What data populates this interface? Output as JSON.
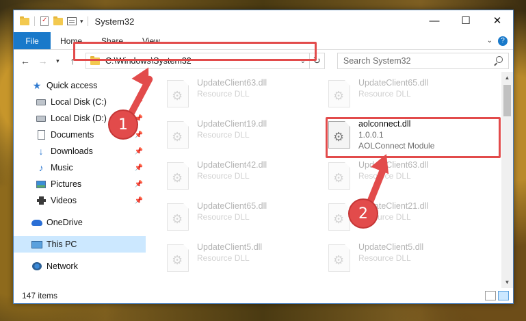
{
  "window": {
    "title": "System32",
    "controls": {
      "minimize": "—",
      "maximize": "☐",
      "close": "✕"
    }
  },
  "ribbon": {
    "tabs": [
      "File",
      "Home",
      "Share",
      "View"
    ]
  },
  "address": {
    "path": "C:\\Windows\\System32"
  },
  "search": {
    "placeholder": "Search System32"
  },
  "nav": {
    "items": [
      {
        "label": "Quick access",
        "icon": "star-icon",
        "pinned": false
      },
      {
        "label": "Local Disk (C:)",
        "icon": "drive-icon",
        "pinned": true
      },
      {
        "label": "Local Disk (D:)",
        "icon": "drive-icon",
        "pinned": true
      },
      {
        "label": "Documents",
        "icon": "documents-icon",
        "pinned": true
      },
      {
        "label": "Downloads",
        "icon": "download-icon",
        "pinned": true
      },
      {
        "label": "Music",
        "icon": "music-icon",
        "pinned": true
      },
      {
        "label": "Pictures",
        "icon": "pictures-icon",
        "pinned": true
      },
      {
        "label": "Videos",
        "icon": "videos-icon",
        "pinned": true
      },
      {
        "label": "OneDrive",
        "icon": "onedrive-icon",
        "pinned": false
      },
      {
        "label": "This PC",
        "icon": "this-pc-icon",
        "pinned": false
      },
      {
        "label": "Network",
        "icon": "network-icon",
        "pinned": false
      }
    ]
  },
  "files": [
    {
      "name": "UpdateClient63.dll",
      "type": "Resource DLL"
    },
    {
      "name": "UpdateClient65.dll",
      "type": "Resource DLL"
    },
    {
      "name": "UpdateClient19.dll",
      "type": "Resource DLL"
    },
    {
      "name": "aolconnect.dll",
      "version": "1.0.0.1",
      "type": "AOLConnect Module"
    },
    {
      "name": "UpdateClient42.dll",
      "type": "Resource DLL"
    },
    {
      "name": "UpdateClient63.dll",
      "type": "Resource DLL"
    },
    {
      "name": "UpdateClient65.dll",
      "type": "Resource DLL"
    },
    {
      "name": "UpdateClient21.dll",
      "type": "Resource DLL"
    },
    {
      "name": "UpdateClient5.dll",
      "type": "Resource DLL"
    },
    {
      "name": "UpdateClient5.dll",
      "type": "Resource DLL"
    }
  ],
  "status": {
    "item_count": "147 items"
  },
  "callouts": [
    "1",
    "2"
  ],
  "colors": {
    "accent": "#1979ca",
    "highlight": "#e24b4b",
    "selected_bg": "#cce8ff"
  }
}
